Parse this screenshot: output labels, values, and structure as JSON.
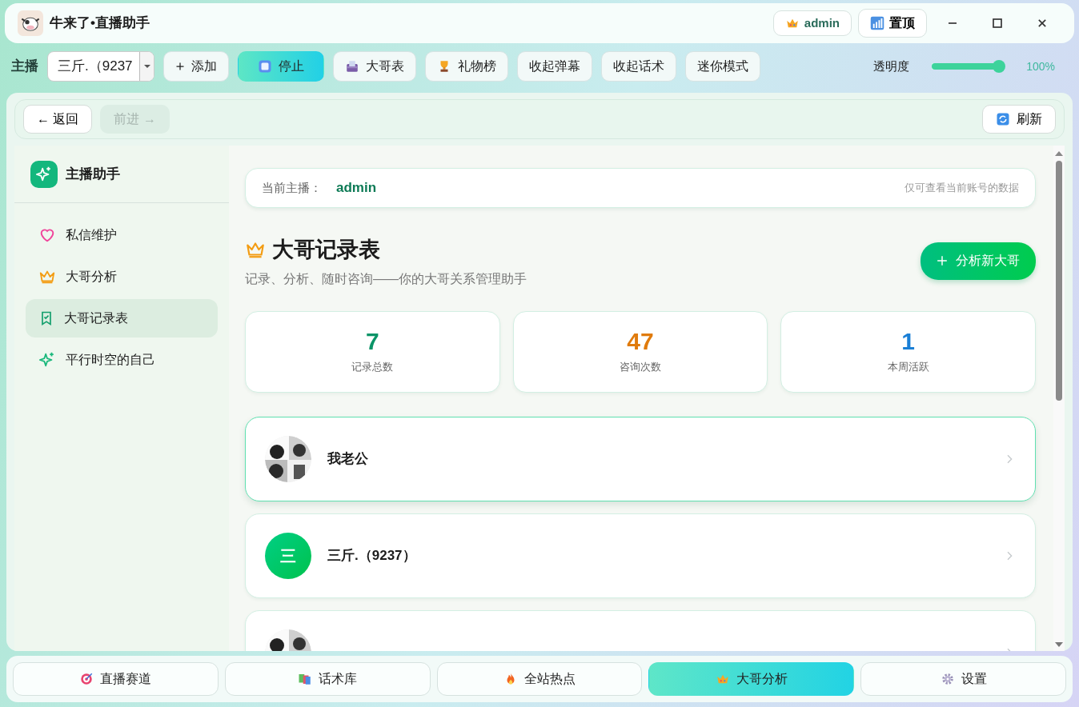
{
  "app": {
    "title": "牛来了•直播助手",
    "user": "admin",
    "pin_button": "置顶"
  },
  "toolbar": {
    "label": "主播",
    "streamer_select": "三斤.（9237",
    "buttons": [
      {
        "label": "添加",
        "kind": "add"
      },
      {
        "label": "停止",
        "kind": "stop"
      },
      {
        "label": "大哥表",
        "kind": "table"
      },
      {
        "label": "礼物榜",
        "kind": "trophy"
      },
      {
        "label": "收起弹幕",
        "kind": "plain"
      },
      {
        "label": "收起话术",
        "kind": "plain"
      },
      {
        "label": "迷你模式",
        "kind": "plain"
      }
    ],
    "opacity_label": "透明度",
    "opacity": {
      "level": 1.0
    },
    "opacity_reading": "100%"
  },
  "nav": {
    "back": "← 返回",
    "forward": "前进 →",
    "forward_disabled": true,
    "refresh": "刷新"
  },
  "sidebar": {
    "brand": "主播助手",
    "items": [
      {
        "label": "私信维护",
        "kind": "heart",
        "selected": false
      },
      {
        "label": "大哥分析",
        "kind": "crown",
        "selected": false
      },
      {
        "label": "大哥记录表",
        "kind": "bookmark",
        "selected": true
      },
      {
        "label": "平行时空的自己",
        "kind": "sparkle",
        "selected": false
      }
    ]
  },
  "content": {
    "current_label": "当前主播：",
    "current_value": "admin",
    "note": "仅可查看当前账号的数据",
    "heading": "大哥记录表",
    "subtitle": "记录、分析、随时咨询——你的大哥关系管理助手",
    "add_button": "分析新大哥",
    "stats": [
      {
        "value": "7",
        "label": "记录总数",
        "color": "#0b9467"
      },
      {
        "value": "47",
        "label": "咨询次数",
        "color": "#e07b0c"
      },
      {
        "value": "1",
        "label": "本周活跃",
        "color": "#1a7fd6"
      }
    ],
    "records": [
      {
        "name": "我老公",
        "kind": "picture",
        "selected": true
      },
      {
        "name": "三斤.（9237）",
        "kind": "letter",
        "initial": "三",
        "selected": false
      },
      {
        "kind": "picture",
        "selected": false
      }
    ]
  },
  "bottom_tabs": [
    {
      "label": "直播赛道",
      "kind": "target",
      "selected": false
    },
    {
      "label": "话术库",
      "kind": "books",
      "selected": false
    },
    {
      "label": "全站热点",
      "kind": "fire",
      "selected": false
    },
    {
      "label": "大哥分析",
      "kind": "crown",
      "selected": true
    },
    {
      "label": "设置",
      "kind": "gear",
      "selected": false
    }
  ]
}
